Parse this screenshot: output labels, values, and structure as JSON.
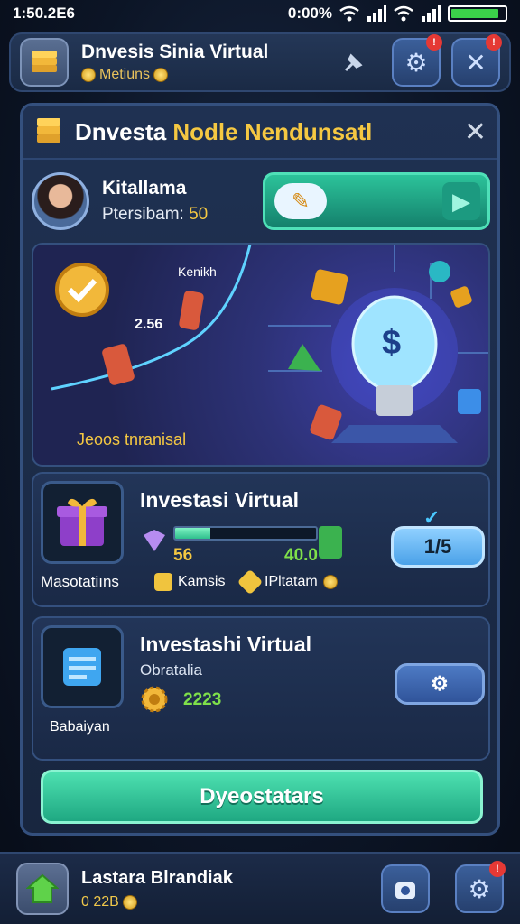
{
  "status_bar": {
    "time": "1:50.2E6",
    "battery_text": "0:00%",
    "battery_level": 0.9
  },
  "top_bar": {
    "title": "Dnvesis Sinia Virtual",
    "subtitle": "Metiuns",
    "settings_badge": "!",
    "close_badge": "!"
  },
  "panel": {
    "title_plain": "Dnvesta",
    "title_gold": "Nodle Nendunsatl",
    "profile": {
      "name": "Kitallama",
      "points_label": "Ptersibam:",
      "points_value": "50"
    }
  },
  "banner": {
    "top_label": "Kenikh",
    "value_label": "2.56",
    "bottom_label": "Jeoos tnranisal",
    "symbol": "$"
  },
  "card1": {
    "title": "Investasi Virtual",
    "progress": 0.25,
    "left_stat": "56",
    "right_stat": "40.0",
    "button_label": "1/5",
    "caption": "Masotatiıns",
    "link1": "Kamsis",
    "link2": "IPltatam"
  },
  "card2": {
    "title": "Investashi Virtual",
    "subtitle": "Obratalia",
    "stat": "2223",
    "caption": "Babaiyan"
  },
  "cta_label": "Dyeostatars",
  "bottom_bar": {
    "title": "Lastara Blrandiak",
    "subtitle": "0 22B",
    "settings_badge": "!"
  }
}
